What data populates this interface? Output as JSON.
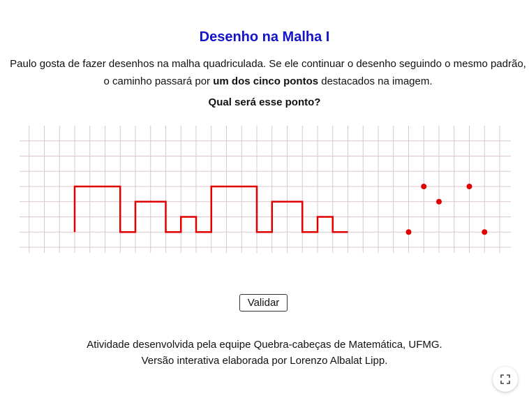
{
  "title": "Desenho na Malha I",
  "description": {
    "part1": "Paulo gosta de fazer desenhos na malha quadriculada. Se ele continuar o desenho seguindo o mesmo padrão, o caminho passará por ",
    "bold": "um dos cinco pontos",
    "part2": " destacados na imagem."
  },
  "question": "Qual será esse ponto?",
  "grid": {
    "line_color": "#d9c7cc",
    "path_color": "#e00000",
    "point_color": "#e00000",
    "path_cells": [
      [
        0,
        3
      ],
      [
        0,
        0
      ],
      [
        3,
        0
      ],
      [
        3,
        3
      ],
      [
        4,
        3
      ],
      [
        4,
        1
      ],
      [
        6,
        1
      ],
      [
        6,
        3
      ],
      [
        7,
        3
      ],
      [
        7,
        2
      ],
      [
        8,
        2
      ],
      [
        8,
        3
      ],
      [
        9,
        3
      ],
      [
        9,
        0
      ],
      [
        12,
        0
      ],
      [
        12,
        3
      ],
      [
        13,
        3
      ],
      [
        13,
        1
      ],
      [
        15,
        1
      ],
      [
        15,
        3
      ],
      [
        16,
        3
      ],
      [
        16,
        2
      ],
      [
        17,
        2
      ],
      [
        17,
        3
      ],
      [
        18,
        3
      ]
    ],
    "points_cells": [
      [
        23,
        0
      ],
      [
        24,
        1
      ],
      [
        26,
        0
      ],
      [
        22,
        3
      ],
      [
        27,
        3
      ]
    ]
  },
  "validate_label": "Validar",
  "footer": {
    "line1": "Atividade desenvolvida pela equipe Quebra-cabeças de Matemática, UFMG.",
    "line2": "Versão interativa elaborada por Lorenzo Albalat Lipp."
  },
  "fullscreen_icon": "fullscreen-icon"
}
